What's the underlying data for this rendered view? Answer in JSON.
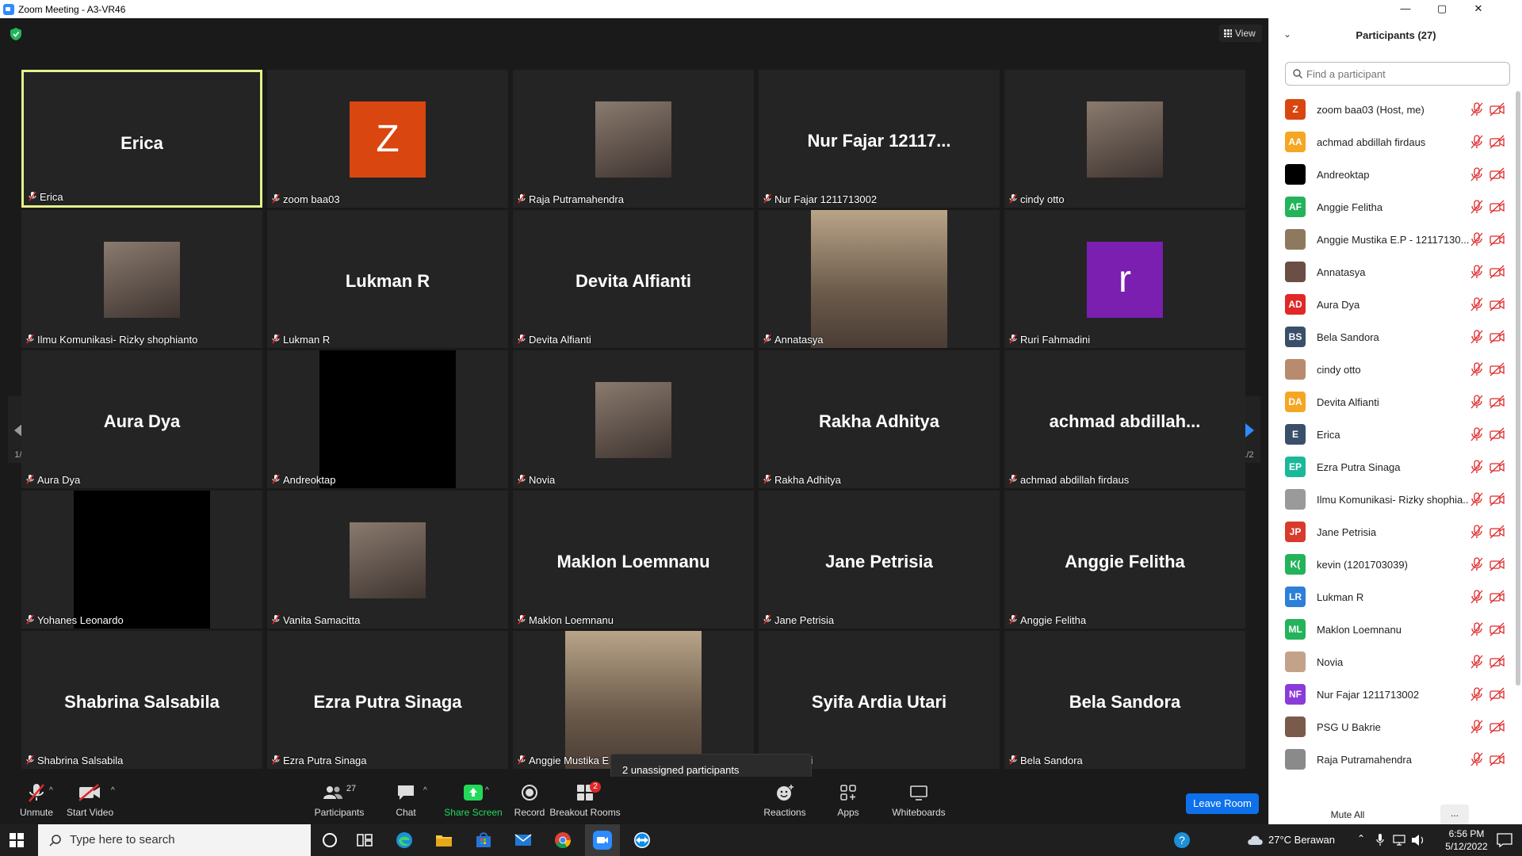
{
  "window": {
    "title": "Zoom Meeting - A3-VR46",
    "minimize": "—",
    "maximize": "▢",
    "close": "✕"
  },
  "meeting": {
    "view_label": "View",
    "page_indicator": "1/2",
    "popup_text": "2 unassigned participants",
    "tiles": [
      {
        "big": "Erica",
        "label": "Erica",
        "kind": "text",
        "active": true
      },
      {
        "big": "",
        "label": "zoom baa03",
        "kind": "letter",
        "letter": "Z",
        "color": "#d9460f"
      },
      {
        "big": "",
        "label": "Raja Putramahendra",
        "kind": "photo"
      },
      {
        "big": "Nur Fajar 12117...",
        "label": "Nur Fajar 1211713002",
        "kind": "text"
      },
      {
        "big": "",
        "label": "cindy otto",
        "kind": "photo"
      },
      {
        "big": "",
        "label": "Ilmu Komunikasi- Rizky shophianto",
        "kind": "photo"
      },
      {
        "big": "Lukman R",
        "label": "Lukman R",
        "kind": "text"
      },
      {
        "big": "Devita Alfianti",
        "label": "Devita Alfianti",
        "kind": "text"
      },
      {
        "big": "",
        "label": "Annatasya",
        "kind": "video"
      },
      {
        "big": "",
        "label": "Ruri Fahmadini",
        "kind": "letter",
        "letter": "r",
        "color": "#7a1fb0"
      },
      {
        "big": "Aura Dya",
        "label": "Aura Dya",
        "kind": "text"
      },
      {
        "big": "",
        "label": "Andreoktap",
        "kind": "black"
      },
      {
        "big": "",
        "label": "Novia",
        "kind": "photo"
      },
      {
        "big": "Rakha Adhitya",
        "label": "Rakha Adhitya",
        "kind": "text"
      },
      {
        "big": "achmad  abdillah...",
        "label": "achmad abdillah firdaus",
        "kind": "text"
      },
      {
        "big": "",
        "label": "Yohanes Leonardo",
        "kind": "black"
      },
      {
        "big": "",
        "label": "Vanita Samacitta",
        "kind": "photo"
      },
      {
        "big": "Maklon Loemnanu",
        "label": "Maklon Loemnanu",
        "kind": "text"
      },
      {
        "big": "Jane Petrisia",
        "label": "Jane Petrisia",
        "kind": "text"
      },
      {
        "big": "Anggie Felitha",
        "label": "Anggie Felitha",
        "kind": "text"
      },
      {
        "big": "Shabrina Salsabila",
        "label": "Shabrina Salsabila",
        "kind": "text"
      },
      {
        "big": "Ezra Putra Sinaga",
        "label": "Ezra Putra Sinaga",
        "kind": "text"
      },
      {
        "big": "",
        "label": "Anggie Mustika E",
        "kind": "video"
      },
      {
        "big": "Syifa Ardia Utari",
        "label": "dia Utari",
        "kind": "text"
      },
      {
        "big": "Bela Sandora",
        "label": "Bela Sandora",
        "kind": "text"
      }
    ]
  },
  "toolbar": {
    "unmute": "Unmute",
    "start_video": "Start Video",
    "participants": "Participants",
    "participants_count": "27",
    "chat": "Chat",
    "share_screen": "Share Screen",
    "record": "Record",
    "breakout_rooms": "Breakout Rooms",
    "breakout_badge": "2",
    "reactions": "Reactions",
    "apps": "Apps",
    "whiteboards": "Whiteboards",
    "leave": "Leave Room"
  },
  "panel": {
    "title": "Participants (27)",
    "search_placeholder": "Find a participant",
    "mute_all": "Mute All",
    "more": "...",
    "participants": [
      {
        "initials": "Z",
        "name": "zoom baa03 (Host, me)",
        "color": "#d9460f"
      },
      {
        "initials": "AA",
        "name": "achmad abdillah firdaus",
        "color": "#f5a623"
      },
      {
        "initials": "",
        "name": "Andreoktap",
        "color": "#000000"
      },
      {
        "initials": "AF",
        "name": "Anggie Felitha",
        "color": "#23b35b"
      },
      {
        "initials": "",
        "name": "Anggie Mustika E.P - 12117130...",
        "color": "#8d7a5e"
      },
      {
        "initials": "",
        "name": "Annatasya",
        "color": "#6b4f45"
      },
      {
        "initials": "AD",
        "name": "Aura Dya",
        "color": "#e02828"
      },
      {
        "initials": "BS",
        "name": "Bela Sandora",
        "color": "#3a4f6a"
      },
      {
        "initials": "",
        "name": "cindy otto",
        "color": "#b88a6e"
      },
      {
        "initials": "DA",
        "name": "Devita Alfianti",
        "color": "#f5a623"
      },
      {
        "initials": "E",
        "name": "Erica",
        "color": "#3a4f6a"
      },
      {
        "initials": "EP",
        "name": "Ezra Putra Sinaga",
        "color": "#1bb89a"
      },
      {
        "initials": "",
        "name": "Ilmu Komunikasi- Rizky shophia...",
        "color": "#9a9a9a"
      },
      {
        "initials": "JP",
        "name": "Jane Petrisia",
        "color": "#d83b2d"
      },
      {
        "initials": "K(",
        "name": "kevin (1201703039)",
        "color": "#23b35b"
      },
      {
        "initials": "LR",
        "name": "Lukman R",
        "color": "#2d7fd8"
      },
      {
        "initials": "ML",
        "name": "Maklon Loemnanu",
        "color": "#23b35b"
      },
      {
        "initials": "",
        "name": "Novia",
        "color": "#c4a28a"
      },
      {
        "initials": "NF",
        "name": "Nur Fajar 1211713002",
        "color": "#8a3bd8"
      },
      {
        "initials": "",
        "name": "PSG U Bakrie",
        "color": "#7a5a4a"
      },
      {
        "initials": "",
        "name": "Raja Putramahendra",
        "color": "#8a8a8a"
      }
    ]
  },
  "taskbar": {
    "search_placeholder": "Type here to search",
    "weather": "27°C  Berawan",
    "time": "6:56 PM",
    "date": "5/12/2022"
  },
  "colors": {
    "active_speaker_border": "#e5f28b",
    "leave_button": "#0e71eb",
    "share_screen": "#23d959",
    "muted_red": "#e02828"
  }
}
